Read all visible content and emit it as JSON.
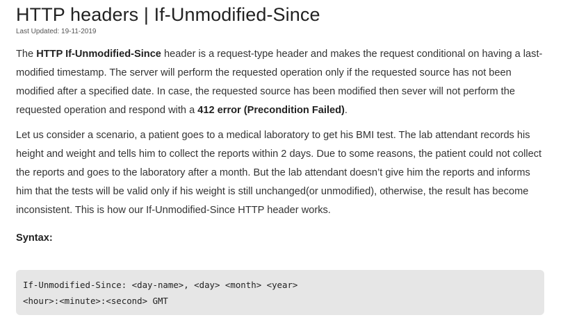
{
  "article": {
    "title": "HTTP headers | If-Unmodified-Since",
    "last_updated": "Last Updated: 19-11-2019",
    "p1": {
      "t1": "The ",
      "b1": "HTTP If-Unmodified-Since",
      "t2": " header is a request-type header and makes the request conditional on having a last-modified timestamp. The server will perform the requested operation only if the requested source has not been modified after a specified date. In case, the requested source has been modified then sever will not perform the requested operation and respond with a ",
      "b2": "412 error (Precondition Failed)",
      "t3": "."
    },
    "p2": "Let us consider a scenario, a patient goes to a medical laboratory to get his BMI test. The lab attendant records his height and weight and tells him to collect the reports within 2 days. Due to some reasons, the patient could not collect the reports and goes to the laboratory after a month. But the lab attendant doesn’t give him the reports and informs him that the tests will be valid only if his weight is still unchanged(or unmodified), otherwise, the result has become inconsistent. This is how our If-Unmodified-Since HTTP header works.",
    "syntax_heading": "Syntax:",
    "code_lines": [
      "If-Unmodified-Since: <day-name>, <day> <month> <year>",
      "<hour>:<minute>:<second> GMT"
    ]
  }
}
